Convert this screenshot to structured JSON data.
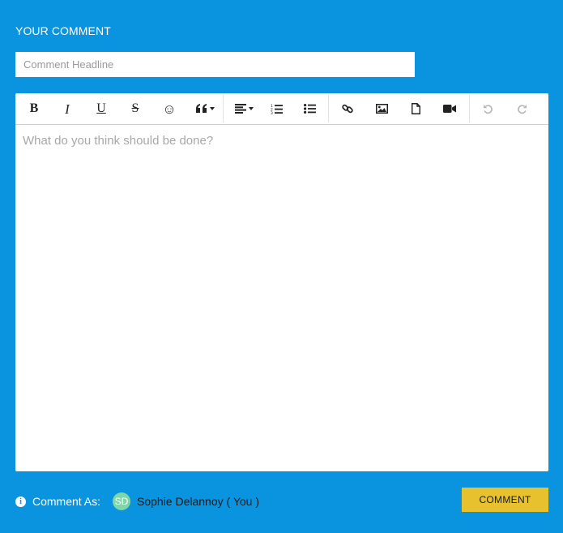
{
  "section": {
    "title": "YOUR COMMENT"
  },
  "headline": {
    "placeholder": "Comment Headline",
    "value": ""
  },
  "toolbar": {
    "bold": "B",
    "italic": "I",
    "underline": "U",
    "strike": "S",
    "emoji": "☺"
  },
  "editor": {
    "placeholder": "What do you think should be done?",
    "value": ""
  },
  "footer": {
    "comment_as_label": "Comment As:",
    "avatar_initials": "SD",
    "user_name": "Sophie Delannoy ( You )",
    "submit_label": "COMMENT"
  },
  "colors": {
    "background": "#0a93de",
    "submit_button": "#e8c22e",
    "avatar": "#7fd6a8",
    "disabled_icon": "#b5b5b5"
  }
}
